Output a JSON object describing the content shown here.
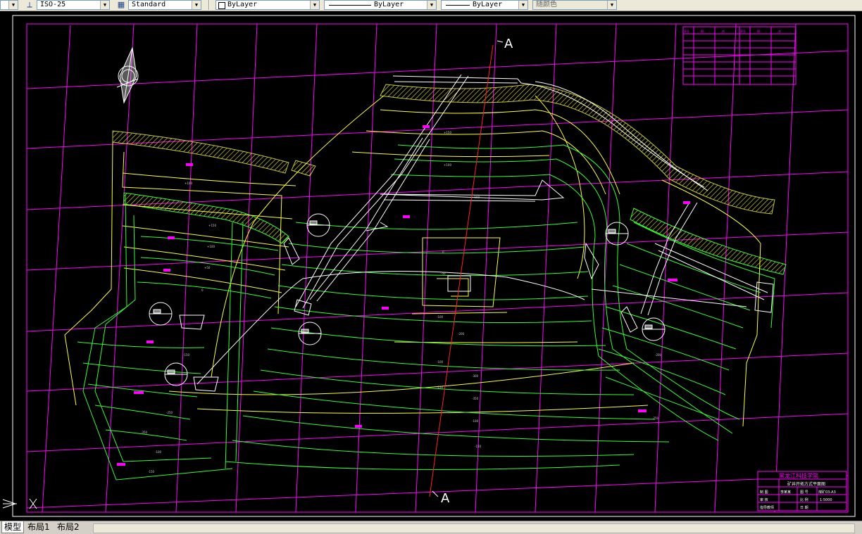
{
  "toolbar": {
    "dimstyle": "ISO-25",
    "tablestyle": "Standard",
    "layer": "ByLayer",
    "linetype": "ByLayer",
    "lineweight": "ByLayer",
    "plotstyle": "随颜色"
  },
  "drawing": {
    "section_label_top": "A",
    "section_label_bottom": "A",
    "legend_header": [
      "序号",
      "图",
      "名",
      "序号",
      "图",
      "名"
    ],
    "titleblock": {
      "org": "黑龙江科技学院",
      "drawing_name": "矿井开拓方式平面图",
      "row2_a": "制 图",
      "row2_b": "李某某",
      "row2_c": "图 号",
      "row2_d": "煤矿03-A3",
      "row3_a": "审 核",
      "row3_c": "比 例",
      "row3_d": "1:5000",
      "row4_a": "指导教师",
      "row4_c": "日 期"
    },
    "contour_labels": [
      "+150",
      "+100",
      "+50",
      "0",
      "-50",
      "-100",
      "-150",
      "-200",
      "-250",
      "-300",
      "-350"
    ]
  },
  "tabs": {
    "model": "模型",
    "layout1": "布局1",
    "layout2": "布局2"
  },
  "colors": {
    "background": "#000000",
    "grid": "#ff00ff",
    "contour_green": "#33ff33",
    "contour_yellow": "#ffff33",
    "section_line": "#ff2222",
    "hatch": "#c8c832"
  }
}
